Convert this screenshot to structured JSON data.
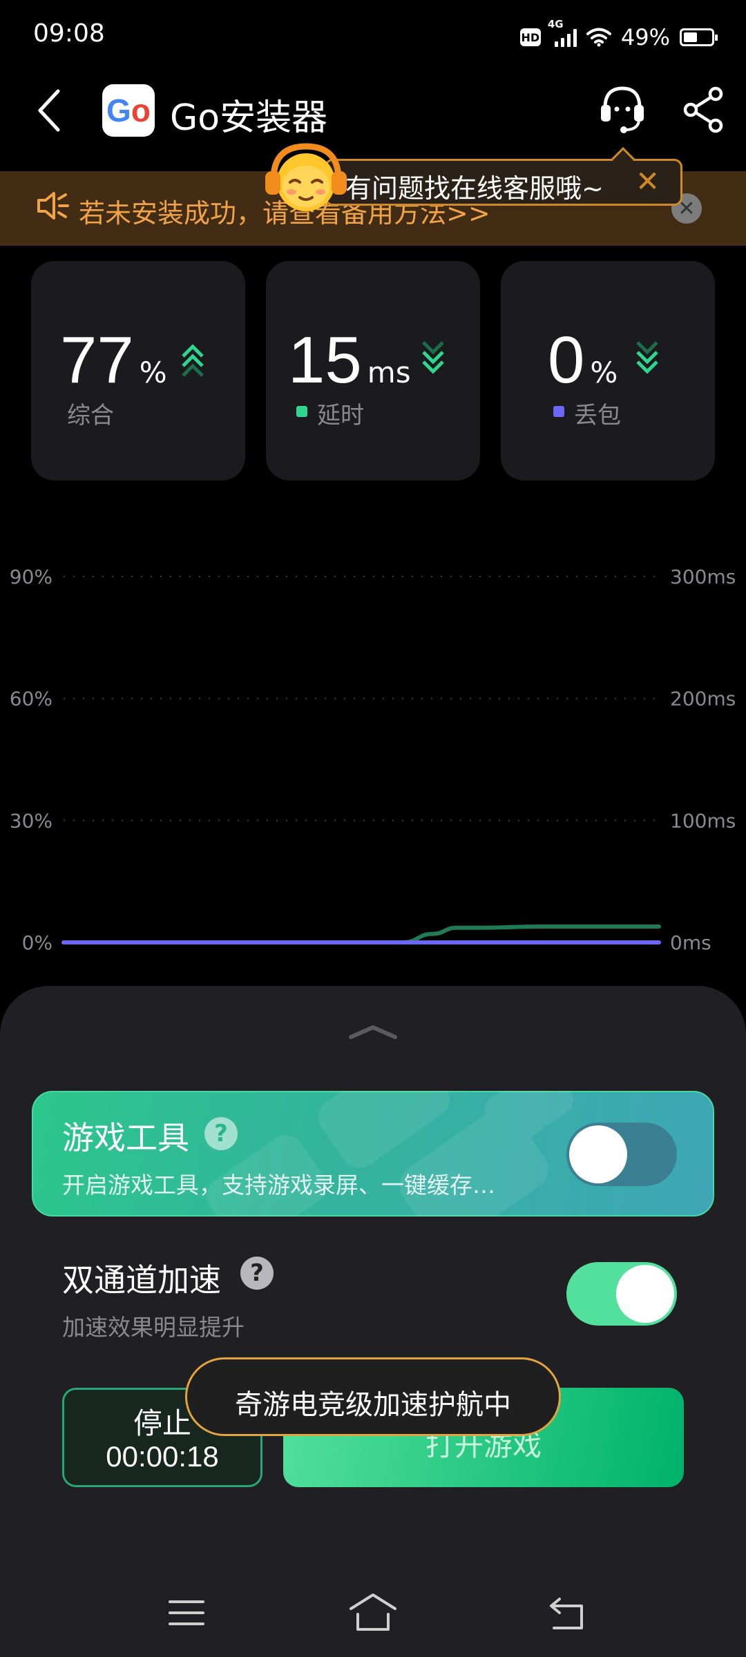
{
  "status_bar": {
    "time": "09:08",
    "network": "4G",
    "hd": "HD",
    "battery": "49%",
    "battery_level": 0.49
  },
  "header": {
    "app_icon_text": "Go",
    "title": "Go安装器"
  },
  "notice": {
    "text": "若未安装成功，请查看备用方法>>",
    "close": "✕"
  },
  "tooltip": {
    "text": "有问题找在线客服哦~",
    "close": "✕"
  },
  "stats": [
    {
      "value": "77",
      "unit": "%",
      "label": "综合",
      "trend": "up",
      "color": "#2ed68e"
    },
    {
      "value": "15",
      "unit": "ms",
      "label": "延时",
      "trend": "down",
      "color": "#2ed68e",
      "dot_color": "#2ed68e"
    },
    {
      "value": "0",
      "unit": "%",
      "label": "丢包",
      "trend": "down",
      "color": "#2ed68e",
      "dot_color": "#6a68f5"
    }
  ],
  "chart": {
    "left_ticks": [
      "90%",
      "60%",
      "30%",
      "0%"
    ],
    "right_ticks": [
      "300ms",
      "200ms",
      "100ms",
      "0ms"
    ],
    "latency_color": "#1f7a55",
    "loss_color": "#6a68f5"
  },
  "chart_data": {
    "type": "line",
    "x": [
      0,
      0.1,
      0.2,
      0.3,
      0.4,
      0.5,
      0.57,
      0.62,
      0.66,
      0.7,
      0.8,
      0.9,
      1.0
    ],
    "series": [
      {
        "name": "延时",
        "axis": "right",
        "values": [
          0,
          0,
          0,
          0,
          0,
          0,
          0,
          7,
          12,
          12,
          13,
          13,
          13
        ]
      },
      {
        "name": "丢包",
        "axis": "left",
        "values": [
          0,
          0,
          0,
          0,
          0,
          0,
          0,
          0,
          0,
          0,
          0,
          0,
          0
        ]
      }
    ],
    "ylim_left": [
      0,
      90
    ],
    "ylim_right": [
      0,
      300
    ],
    "grid": true
  },
  "tools": {
    "title": "游戏工具",
    "help": "?",
    "desc": "开启游戏工具，支持游戏录屏、一键缓存…",
    "enabled": false
  },
  "dual_channel": {
    "title": "双通道加速",
    "help": "?",
    "desc": "加速效果明显提升",
    "enabled": true
  },
  "actions": {
    "stop_label": "停止",
    "timer": "00:00:18",
    "open_label": "打开游戏"
  },
  "toast": {
    "text": "奇游电竞级加速护航中"
  }
}
